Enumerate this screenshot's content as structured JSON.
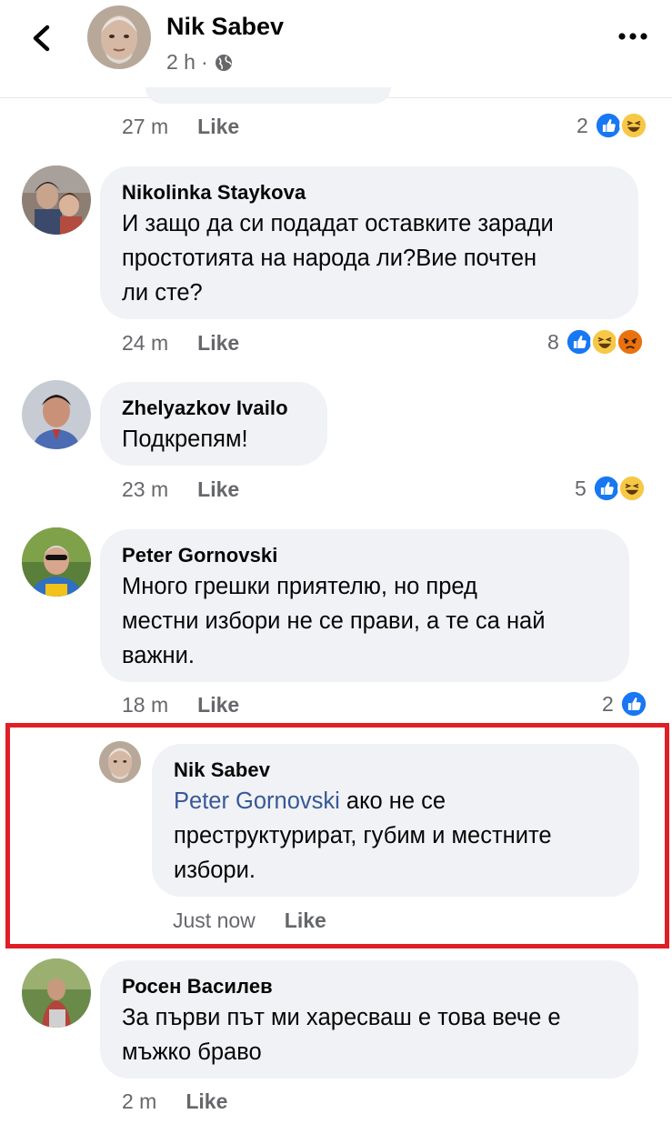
{
  "header": {
    "name": "Nik Sabev",
    "time": "2 h",
    "privacy_icon": "globe-icon",
    "back_icon": "chevron-left-icon",
    "more_icon": "ellipsis-icon"
  },
  "first_meta": {
    "time": "27 m",
    "like": "Like",
    "reaction_count": "2"
  },
  "comments": [
    {
      "author": "Nikolinka Staykova",
      "lines": [
        "И защо да си подадат оставките заради",
        "простотията на народа ли?Вие почтен",
        "ли сте?"
      ],
      "time": "24 m",
      "like": "Like",
      "reaction_count": "8"
    },
    {
      "author": "Zhelyazkov Ivailo",
      "lines": [
        "Подкрепям!"
      ],
      "time": "23 m",
      "like": "Like",
      "reaction_count": "5"
    },
    {
      "author": "Peter Gornovski",
      "lines": [
        "Много грешки приятелю, но пред",
        "местни избори не се прави, а те са най",
        "важни."
      ],
      "time": "18 m",
      "like": "Like",
      "reaction_count": "2"
    },
    {
      "author": "Nik Sabev",
      "mention": "Peter Gornovski",
      "lines": [
        " ако не се",
        "преструктурират, губим и местните",
        "избори."
      ],
      "time": "Just now",
      "like": "Like"
    },
    {
      "author": "Росен Василев",
      "lines": [
        "За първи път ми хaресваш е това вече е",
        "мъжко браво"
      ],
      "time": "2 m",
      "like": "Like"
    }
  ],
  "colors": {
    "bubble": "#f0f2f5",
    "secondary_text": "#65676b",
    "mention": "#385898",
    "highlight": "#e01e26",
    "like_blue": "#1877f2",
    "haha_yellow": "#f7c846",
    "angry_orange": "#e9710f"
  }
}
